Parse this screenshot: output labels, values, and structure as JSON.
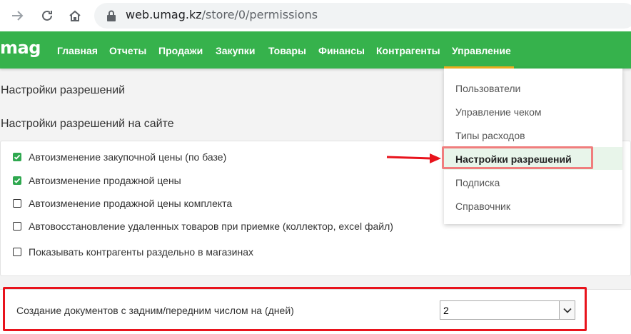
{
  "browser": {
    "url_host": "web.umag.kz",
    "url_path": "/store/0/permissions"
  },
  "app": {
    "logo": "mag",
    "menu": [
      "Главная",
      "Отчеты",
      "Продажи",
      "Закупки",
      "Товары",
      "Финансы",
      "Контрагенты",
      "Управление"
    ],
    "active_menu": "Управление",
    "accent_color": "#36b24c"
  },
  "page": {
    "title": "Настройки разрешений",
    "section_title": "Настройки разрешений на сайте"
  },
  "options": [
    {
      "label": "Автоизменение закупочной цены (по базе)",
      "checked": true
    },
    {
      "label": "Автоизменение продажной цены",
      "checked": true
    },
    {
      "label": "Автоизменение продажной цены комплекта",
      "checked": false
    },
    {
      "label": "Автовосстановление удаленных товаров при приемке (коллектор, excel файл)",
      "checked": false
    },
    {
      "label": "Показывать контрагенты раздельно в магазинах",
      "checked": false
    }
  ],
  "days_setting": {
    "label": "Создание документов с задним/передним числом на (дней)",
    "value": "2"
  },
  "dropdown": {
    "items": [
      "Пользователи",
      "Управление чеком",
      "Типы расходов",
      "Настройки разрешений",
      "Подписка",
      "Справочник"
    ],
    "active": "Настройки разрешений"
  }
}
